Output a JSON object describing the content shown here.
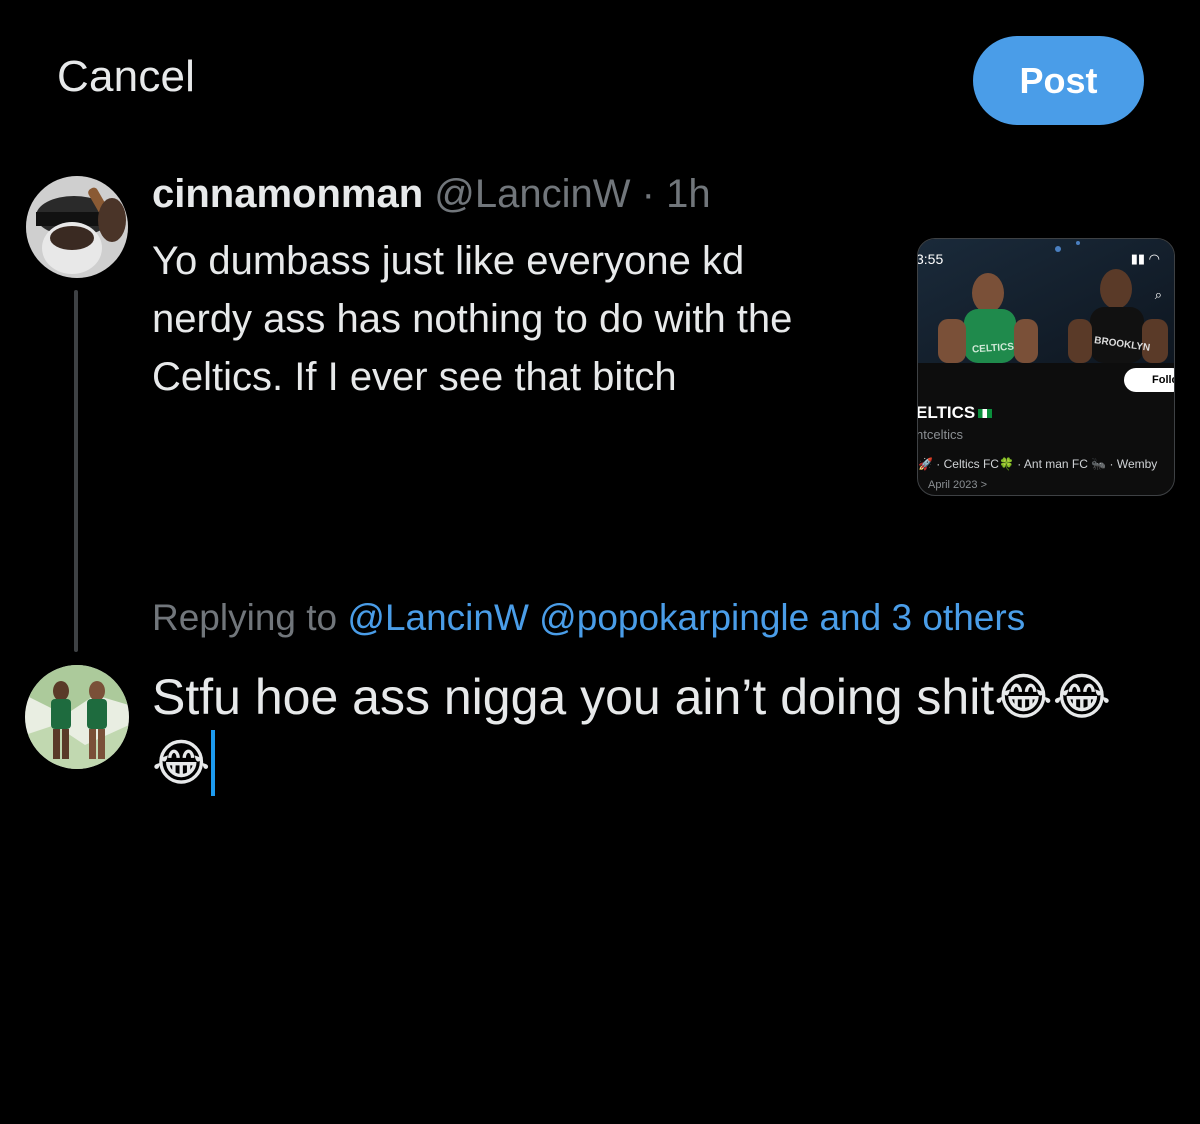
{
  "header": {
    "cancel_label": "Cancel",
    "post_label": "Post"
  },
  "quoted_tweet": {
    "display_name": "cinnamonman",
    "handle": "@LancinW",
    "separator": "·",
    "time": "1h",
    "text": "Yo dumbass just like everyone kd nerdy ass has nothing to do with the Celtics. If I ever see that bitch"
  },
  "attachment": {
    "status_time": "3:55",
    "follow_label": "Follo",
    "profile_name": "ELTICS",
    "profile_handle": "ntceltics",
    "bio": "🚀 · Celtics FC🍀 · Ant man FC 🐜 · Wemby",
    "joined": "April 2023 >",
    "jersey_left": "CELTICS",
    "jersey_right": "BROOKLYN"
  },
  "reply": {
    "replying_prefix": "Replying to",
    "mentions": "@LancinW @popokarpingle and 3 others",
    "compose_text": "Stfu hoe ass nigga you ain’t doing shit😂😂😂"
  },
  "colors": {
    "accent": "#4a9de8",
    "background": "#000000",
    "text": "#e7e9ea",
    "muted": "#71767b"
  }
}
